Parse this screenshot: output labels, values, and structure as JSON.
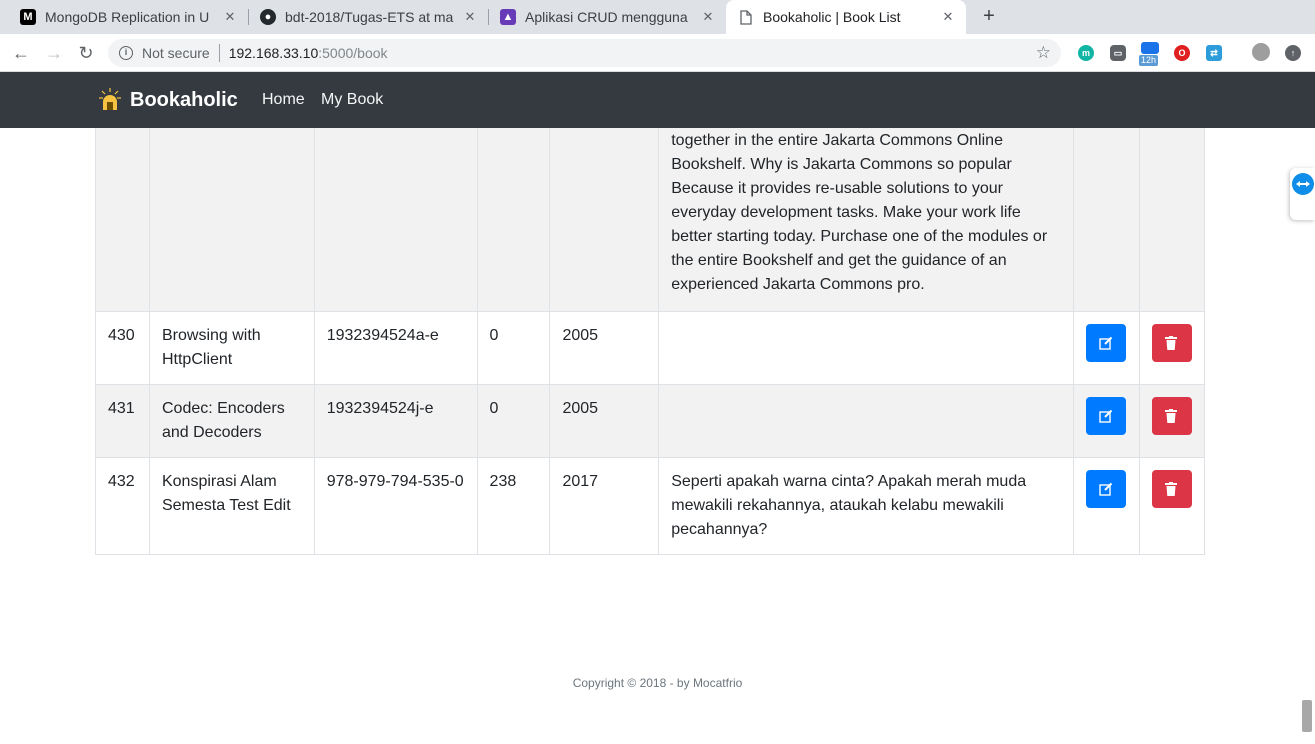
{
  "browser": {
    "tabs": [
      {
        "title": "MongoDB Replication in U",
        "favicon": "medium-icon",
        "active": false
      },
      {
        "title": "bdt-2018/Tugas-ETS at ma",
        "favicon": "github-icon",
        "active": false
      },
      {
        "title": "Aplikasi CRUD mengguna",
        "favicon": "app-icon",
        "active": false
      },
      {
        "title": "Bookaholic | Book List",
        "favicon": "page-icon",
        "active": true
      }
    ],
    "address": {
      "security_label": "Not secure",
      "host": "192.168.33.10",
      "path": ":5000/book"
    },
    "extension_badge": "12h"
  },
  "navbar": {
    "brand": "Bookaholic",
    "links": [
      "Home",
      "My Book"
    ]
  },
  "books": {
    "partial_row": {
      "description": "together in the entire Jakarta Commons Online Bookshelf. Why is Jakarta Commons so popular Because it provides re-usable solutions to your everyday development tasks. Make your work life better starting today. Purchase one of the modules or the entire Bookshelf and get the guidance of an experienced Jakarta Commons pro."
    },
    "rows": [
      {
        "id": "430",
        "title": "Browsing with HttpClient",
        "isbn": "1932394524a-e",
        "pages": "0",
        "year": "2005",
        "description": ""
      },
      {
        "id": "431",
        "title": "Codec: Encoders and Decoders",
        "isbn": "1932394524j-e",
        "pages": "0",
        "year": "2005",
        "description": ""
      },
      {
        "id": "432",
        "title": "Konspirasi Alam Semesta Test Edit",
        "isbn": "978-979-794-535-0",
        "pages": "238",
        "year": "2017",
        "description": "Seperti apakah warna cinta? Apakah merah muda mewakili rekahannya, ataukah kelabu mewakili pecahannya?"
      }
    ]
  },
  "footer": {
    "text": "Copyright © 2018 - by Mocatfrio"
  },
  "colors": {
    "navbar_bg": "#343a40",
    "edit_button": "#007bff",
    "delete_button": "#dc3545",
    "stripe": "#f2f2f2"
  }
}
